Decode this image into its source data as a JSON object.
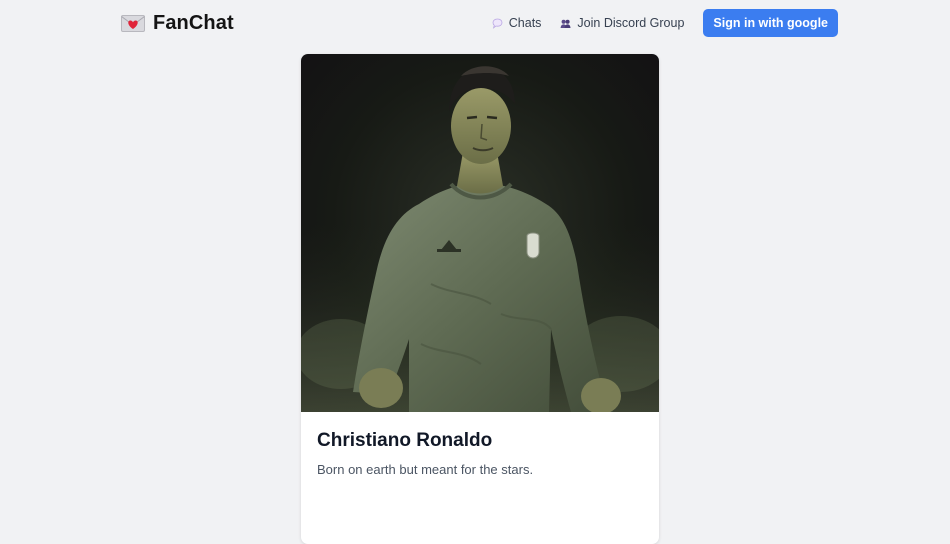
{
  "brand": {
    "name": "FanChat",
    "icon": "heart-envelope-icon"
  },
  "nav": {
    "chats_label": "Chats",
    "chats_icon": "speech-bubble-icon",
    "discord_label": "Join Discord Group",
    "discord_icon": "users-icon",
    "signin_label": "Sign in with google"
  },
  "card": {
    "title": "Christiano Ronaldo",
    "description": "Born on earth but meant for the stars.",
    "image": "football-player-portrait"
  },
  "colors": {
    "background": "#f1f2f4",
    "accent": "#3b7df0",
    "card": "#ffffff"
  }
}
